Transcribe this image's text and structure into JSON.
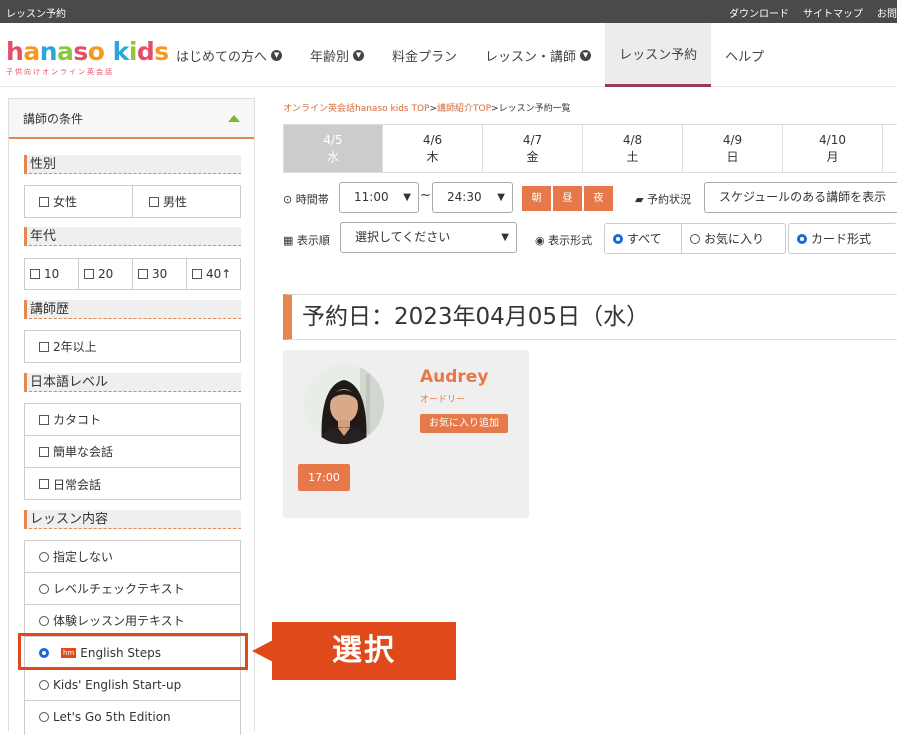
{
  "topbar": {
    "title": "レッスン予約",
    "links": [
      "ダウンロード",
      "サイトマップ",
      "お問"
    ]
  },
  "logo": {
    "main": "hanaso kids",
    "sub": "子供向けオンライン英会話"
  },
  "nav": {
    "items": [
      {
        "label": "はじめての方へ",
        "chevron": true
      },
      {
        "label": "年齢別",
        "chevron": true
      },
      {
        "label": "料金プラン",
        "chevron": false
      },
      {
        "label": "レッスン・講師",
        "chevron": true
      },
      {
        "label": "レッスン予約",
        "chevron": false,
        "active": true
      },
      {
        "label": "ヘルプ",
        "chevron": false
      }
    ]
  },
  "sidebar": {
    "title": "講師の条件",
    "gender": {
      "title": "性別",
      "options": [
        "女性",
        "男性"
      ]
    },
    "age": {
      "title": "年代",
      "options": [
        "10",
        "20",
        "30",
        "40↑"
      ]
    },
    "career": {
      "title": "講師歴",
      "options": [
        "2年以上"
      ]
    },
    "japanese": {
      "title": "日本語レベル",
      "options": [
        "カタコト",
        "簡単な会話",
        "日常会話"
      ]
    },
    "lesson": {
      "title": "レッスン内容",
      "options": [
        "指定しない",
        "レベルチェックテキスト",
        "体験レッスン用テキスト",
        "English Steps",
        "Kids' English Start-up",
        "Let's Go 5th Edition"
      ],
      "selected": 3,
      "badge": "hm"
    }
  },
  "breadcrumb": {
    "links": [
      "オンライン英会話hanaso kids TOP",
      "講師紹介TOP"
    ],
    "sep": ">",
    "current": "レッスン予約一覧"
  },
  "dates": [
    {
      "date": "4/5",
      "day": "水",
      "active": true
    },
    {
      "date": "4/6",
      "day": "木"
    },
    {
      "date": "4/7",
      "day": "金"
    },
    {
      "date": "4/8",
      "day": "土"
    },
    {
      "date": "4/9",
      "day": "日"
    },
    {
      "date": "4/10",
      "day": "月"
    }
  ],
  "controls": {
    "time_label": "時間帯",
    "time_from": "11:00",
    "tilde": "~",
    "time_to": "24:30",
    "period_buttons": [
      "朝",
      "昼",
      "夜"
    ],
    "status_label": "予約状況",
    "status_value": "スケジュールのある講師を表示",
    "order_label": "表示順",
    "order_placeholder": "選択してください",
    "format_label": "表示形式",
    "filter_all": "すべて",
    "filter_fav": "お気に入り",
    "view_card": "カード形式"
  },
  "result": {
    "title": "予約日：2023年04月05日（水）"
  },
  "teacher": {
    "name": "Audrey",
    "kana": "オードリー",
    "fav_button": "お気に入り追加",
    "slot": "17:00"
  },
  "callout": {
    "label": "選択"
  },
  "colors": {
    "accent": "#e6784a",
    "callout": "#e04a1a",
    "nav_active": "#9b3a54",
    "radio_on": "#1769d6"
  }
}
